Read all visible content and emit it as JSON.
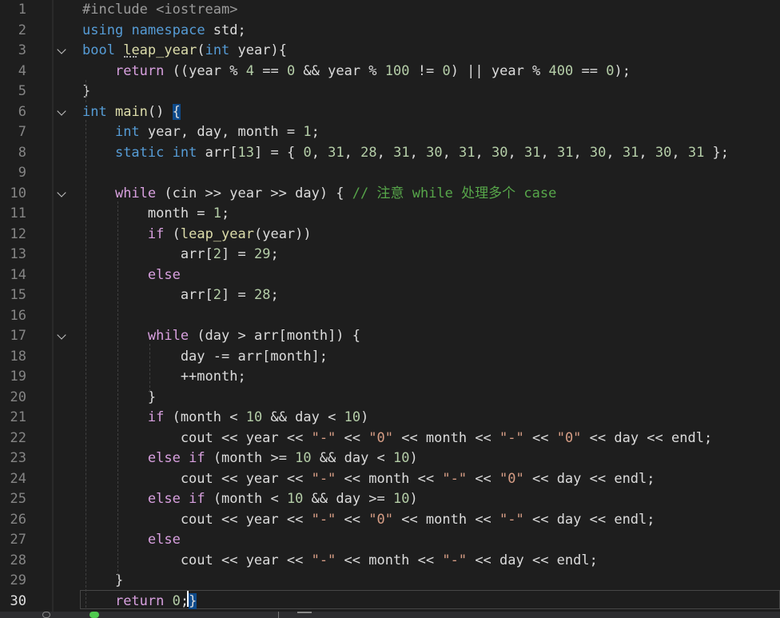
{
  "editor": {
    "active_line": 30,
    "lines": [
      {
        "n": "1",
        "fold": false,
        "tokens": [
          {
            "t": "#include <iostream>",
            "c": "pp"
          }
        ]
      },
      {
        "n": "2",
        "fold": false,
        "tokens": [
          {
            "t": "using",
            "c": "kw"
          },
          {
            "t": " "
          },
          {
            "t": "namespace",
            "c": "kw"
          },
          {
            "t": " std;"
          }
        ]
      },
      {
        "n": "3",
        "fold": true,
        "tokens": [
          {
            "t": "bool",
            "c": "kw"
          },
          {
            "t": " "
          },
          {
            "t": "leap_year",
            "c": "fn"
          },
          {
            "t": "("
          },
          {
            "t": "int",
            "c": "kw"
          },
          {
            "t": " year){"
          }
        ]
      },
      {
        "n": "4",
        "fold": false,
        "tokens": [
          {
            "t": "    "
          },
          {
            "t": "return",
            "c": "ctl"
          },
          {
            "t": " ((year % "
          },
          {
            "t": "4",
            "c": "num"
          },
          {
            "t": " == "
          },
          {
            "t": "0",
            "c": "num"
          },
          {
            "t": " && year % "
          },
          {
            "t": "100",
            "c": "num"
          },
          {
            "t": " != "
          },
          {
            "t": "0",
            "c": "num"
          },
          {
            "t": ") || year % "
          },
          {
            "t": "400",
            "c": "num"
          },
          {
            "t": " == "
          },
          {
            "t": "0",
            "c": "num"
          },
          {
            "t": ");"
          }
        ]
      },
      {
        "n": "5",
        "fold": false,
        "tokens": [
          {
            "t": "}"
          }
        ]
      },
      {
        "n": "6",
        "fold": true,
        "tokens": [
          {
            "t": "int",
            "c": "kw"
          },
          {
            "t": " "
          },
          {
            "t": "main",
            "c": "fn"
          },
          {
            "t": "() "
          },
          {
            "t": "{",
            "c": "hl-brace"
          }
        ]
      },
      {
        "n": "7",
        "fold": false,
        "tokens": [
          {
            "t": "    "
          },
          {
            "t": "int",
            "c": "kw"
          },
          {
            "t": " year, day, month = "
          },
          {
            "t": "1",
            "c": "num"
          },
          {
            "t": ";"
          }
        ]
      },
      {
        "n": "8",
        "fold": false,
        "tokens": [
          {
            "t": "    "
          },
          {
            "t": "static",
            "c": "kw"
          },
          {
            "t": " "
          },
          {
            "t": "int",
            "c": "kw"
          },
          {
            "t": " arr["
          },
          {
            "t": "13",
            "c": "num"
          },
          {
            "t": "] = { "
          },
          {
            "t": "0",
            "c": "num"
          },
          {
            "t": ", "
          },
          {
            "t": "31",
            "c": "num"
          },
          {
            "t": ", "
          },
          {
            "t": "28",
            "c": "num"
          },
          {
            "t": ", "
          },
          {
            "t": "31",
            "c": "num"
          },
          {
            "t": ", "
          },
          {
            "t": "30",
            "c": "num"
          },
          {
            "t": ", "
          },
          {
            "t": "31",
            "c": "num"
          },
          {
            "t": ", "
          },
          {
            "t": "30",
            "c": "num"
          },
          {
            "t": ", "
          },
          {
            "t": "31",
            "c": "num"
          },
          {
            "t": ", "
          },
          {
            "t": "31",
            "c": "num"
          },
          {
            "t": ", "
          },
          {
            "t": "30",
            "c": "num"
          },
          {
            "t": ", "
          },
          {
            "t": "31",
            "c": "num"
          },
          {
            "t": ", "
          },
          {
            "t": "30",
            "c": "num"
          },
          {
            "t": ", "
          },
          {
            "t": "31",
            "c": "num"
          },
          {
            "t": " };"
          }
        ]
      },
      {
        "n": "9",
        "fold": false,
        "tokens": []
      },
      {
        "n": "10",
        "fold": true,
        "tokens": [
          {
            "t": "    "
          },
          {
            "t": "while",
            "c": "ctl"
          },
          {
            "t": " (cin >> year >> day) { "
          },
          {
            "t": "// 注意 while 处理多个 case",
            "c": "cmt"
          }
        ]
      },
      {
        "n": "11",
        "fold": false,
        "tokens": [
          {
            "t": "        month = "
          },
          {
            "t": "1",
            "c": "num"
          },
          {
            "t": ";"
          }
        ]
      },
      {
        "n": "12",
        "fold": false,
        "tokens": [
          {
            "t": "        "
          },
          {
            "t": "if",
            "c": "ctl"
          },
          {
            "t": " ("
          },
          {
            "t": "leap_year",
            "c": "fn"
          },
          {
            "t": "(year))"
          }
        ]
      },
      {
        "n": "13",
        "fold": false,
        "tokens": [
          {
            "t": "            arr["
          },
          {
            "t": "2",
            "c": "num"
          },
          {
            "t": "] = "
          },
          {
            "t": "29",
            "c": "num"
          },
          {
            "t": ";"
          }
        ]
      },
      {
        "n": "14",
        "fold": false,
        "tokens": [
          {
            "t": "        "
          },
          {
            "t": "else",
            "c": "ctl"
          }
        ]
      },
      {
        "n": "15",
        "fold": false,
        "tokens": [
          {
            "t": "            arr["
          },
          {
            "t": "2",
            "c": "num"
          },
          {
            "t": "] = "
          },
          {
            "t": "28",
            "c": "num"
          },
          {
            "t": ";"
          }
        ]
      },
      {
        "n": "16",
        "fold": false,
        "tokens": []
      },
      {
        "n": "17",
        "fold": true,
        "tokens": [
          {
            "t": "        "
          },
          {
            "t": "while",
            "c": "ctl"
          },
          {
            "t": " (day > arr[month]) {"
          }
        ]
      },
      {
        "n": "18",
        "fold": false,
        "tokens": [
          {
            "t": "            day -= arr[month];"
          }
        ]
      },
      {
        "n": "19",
        "fold": false,
        "tokens": [
          {
            "t": "            ++month;"
          }
        ]
      },
      {
        "n": "20",
        "fold": false,
        "tokens": [
          {
            "t": "        }"
          }
        ]
      },
      {
        "n": "21",
        "fold": false,
        "tokens": [
          {
            "t": "        "
          },
          {
            "t": "if",
            "c": "ctl"
          },
          {
            "t": " (month < "
          },
          {
            "t": "10",
            "c": "num"
          },
          {
            "t": " && day < "
          },
          {
            "t": "10",
            "c": "num"
          },
          {
            "t": ")"
          }
        ]
      },
      {
        "n": "22",
        "fold": false,
        "tokens": [
          {
            "t": "            cout << year << "
          },
          {
            "t": "\"-\"",
            "c": "str"
          },
          {
            "t": " << "
          },
          {
            "t": "\"0\"",
            "c": "str"
          },
          {
            "t": " << month << "
          },
          {
            "t": "\"-\"",
            "c": "str"
          },
          {
            "t": " << "
          },
          {
            "t": "\"0\"",
            "c": "str"
          },
          {
            "t": " << day << endl;"
          }
        ]
      },
      {
        "n": "23",
        "fold": false,
        "tokens": [
          {
            "t": "        "
          },
          {
            "t": "else",
            "c": "ctl"
          },
          {
            "t": " "
          },
          {
            "t": "if",
            "c": "ctl"
          },
          {
            "t": " (month >= "
          },
          {
            "t": "10",
            "c": "num"
          },
          {
            "t": " && day < "
          },
          {
            "t": "10",
            "c": "num"
          },
          {
            "t": ")"
          }
        ]
      },
      {
        "n": "24",
        "fold": false,
        "tokens": [
          {
            "t": "            cout << year << "
          },
          {
            "t": "\"-\"",
            "c": "str"
          },
          {
            "t": " << month << "
          },
          {
            "t": "\"-\"",
            "c": "str"
          },
          {
            "t": " << "
          },
          {
            "t": "\"0\"",
            "c": "str"
          },
          {
            "t": " << day << endl;"
          }
        ]
      },
      {
        "n": "25",
        "fold": false,
        "tokens": [
          {
            "t": "        "
          },
          {
            "t": "else",
            "c": "ctl"
          },
          {
            "t": " "
          },
          {
            "t": "if",
            "c": "ctl"
          },
          {
            "t": " (month < "
          },
          {
            "t": "10",
            "c": "num"
          },
          {
            "t": " && day >= "
          },
          {
            "t": "10",
            "c": "num"
          },
          {
            "t": ")"
          }
        ]
      },
      {
        "n": "26",
        "fold": false,
        "tokens": [
          {
            "t": "            cout << year << "
          },
          {
            "t": "\"-\"",
            "c": "str"
          },
          {
            "t": " << "
          },
          {
            "t": "\"0\"",
            "c": "str"
          },
          {
            "t": " << month << "
          },
          {
            "t": "\"-\"",
            "c": "str"
          },
          {
            "t": " << day << endl;"
          }
        ]
      },
      {
        "n": "27",
        "fold": false,
        "tokens": [
          {
            "t": "        "
          },
          {
            "t": "else",
            "c": "ctl"
          }
        ]
      },
      {
        "n": "28",
        "fold": false,
        "tokens": [
          {
            "t": "            cout << year << "
          },
          {
            "t": "\"-\"",
            "c": "str"
          },
          {
            "t": " << month << "
          },
          {
            "t": "\"-\"",
            "c": "str"
          },
          {
            "t": " << day << endl;"
          }
        ]
      },
      {
        "n": "29",
        "fold": false,
        "tokens": [
          {
            "t": "    }"
          }
        ]
      },
      {
        "n": "30",
        "fold": false,
        "tokens": [
          {
            "t": "    "
          },
          {
            "t": "return",
            "c": "ctl"
          },
          {
            "t": " "
          },
          {
            "t": "0",
            "c": "num"
          },
          {
            "t": ";"
          },
          {
            "t": "}",
            "c": "hl-brace"
          }
        ]
      }
    ]
  },
  "theme": {
    "background": "#1e1e1e",
    "keyword": "#569cd6",
    "control": "#d8a0df",
    "function": "#dcdcaa",
    "number": "#b5cea8",
    "string": "#d69d85",
    "comment": "#57a64a",
    "line_number": "#858585"
  },
  "icons": [
    "fold-chevron-icon"
  ]
}
